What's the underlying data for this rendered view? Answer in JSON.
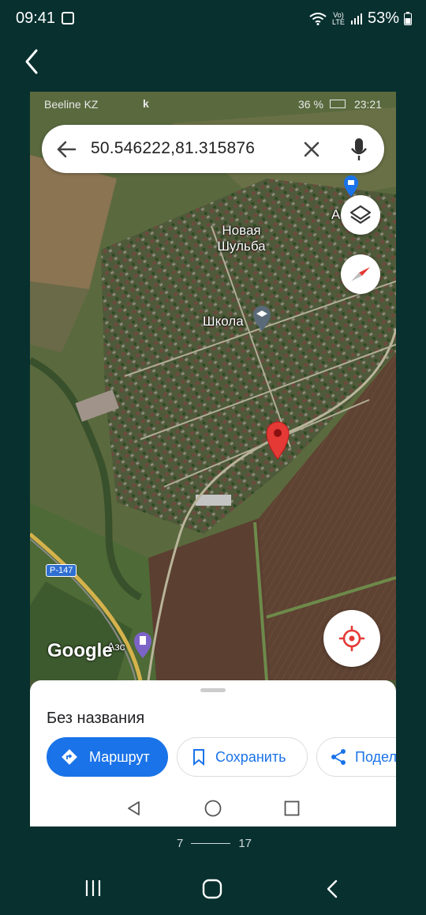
{
  "status_bar": {
    "time": "09:41",
    "volte": "Vo) LTE",
    "battery": "53%"
  },
  "frame": {
    "status_bar": {
      "carrier": "Beeline KZ",
      "battery": "36 %",
      "time": "23:21"
    },
    "search": {
      "query": "50.546222,81.315876"
    },
    "map": {
      "labels": {
        "village": "Новая Шульба",
        "school": "Школа",
        "gas": "Азс",
        "road": "P-147",
        "poi_a": "А"
      },
      "attribution": "Google",
      "colors": {
        "pin": "#e53935",
        "poi_blue": "#1a73e8"
      }
    },
    "sheet": {
      "place_name": "Без названия",
      "route_label": "Маршрут",
      "save_label": "Сохранить",
      "share_label": "Подел"
    }
  },
  "pager": {
    "current": "7",
    "total": "17"
  }
}
